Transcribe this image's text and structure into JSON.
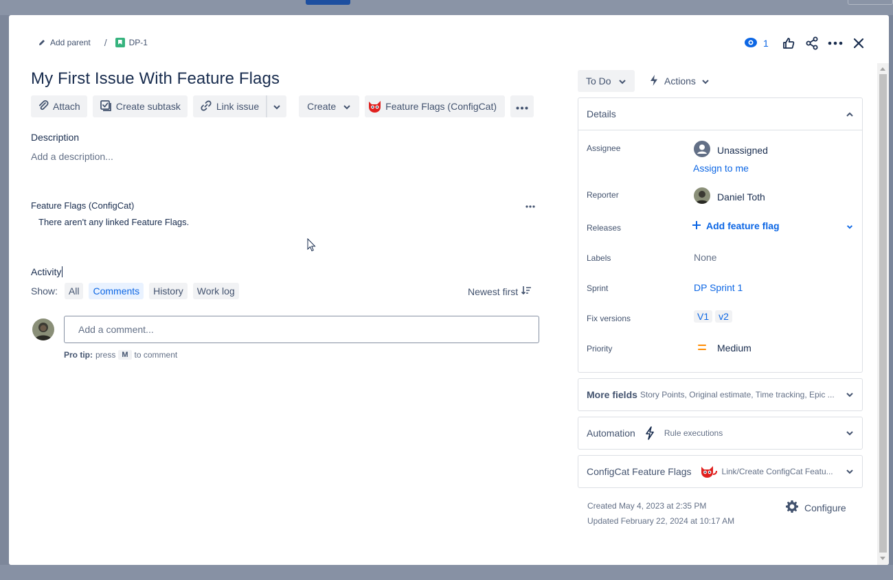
{
  "breadcrumb": {
    "add_parent": "Add parent",
    "separator": "/",
    "issue_key": "DP-1"
  },
  "top_actions": {
    "watch_count": "1"
  },
  "issue": {
    "title": "My First Issue With Feature Flags"
  },
  "toolbar": {
    "attach": "Attach",
    "create_subtask": "Create subtask",
    "link_issue": "Link issue",
    "create": "Create",
    "feature_flags": "Feature Flags (ConfigCat)"
  },
  "description": {
    "label": "Description",
    "placeholder": "Add a description..."
  },
  "feature_flags_section": {
    "label": "Feature Flags (ConfigCat)",
    "empty": "There aren't any linked Feature Flags."
  },
  "activity": {
    "label": "Activity",
    "show_label": "Show:",
    "filters": [
      "All",
      "Comments",
      "History",
      "Work log"
    ],
    "active_filter": "Comments",
    "sort": "Newest first",
    "comment_placeholder": "Add a comment...",
    "protip_bold": "Pro tip:",
    "protip_press": "press",
    "protip_key": "M",
    "protip_rest": "to comment"
  },
  "status": {
    "label": "To Do",
    "actions_label": "Actions"
  },
  "details": {
    "header": "Details",
    "assignee_label": "Assignee",
    "assignee_value": "Unassigned",
    "assign_to_me": "Assign to me",
    "reporter_label": "Reporter",
    "reporter_value": "Daniel Toth",
    "releases_label": "Releases",
    "releases_value": "Add feature flag",
    "labels_label": "Labels",
    "labels_value": "None",
    "sprint_label": "Sprint",
    "sprint_value": "DP Sprint 1",
    "fix_versions_label": "Fix versions",
    "fix_versions": [
      "V1",
      "v2"
    ],
    "priority_label": "Priority",
    "priority_value": "Medium"
  },
  "more_fields": {
    "label": "More fields",
    "sub": "Story Points, Original estimate, Time tracking, Epic ..."
  },
  "automation": {
    "label": "Automation",
    "sub": "Rule executions"
  },
  "configcat": {
    "label": "ConfigCat Feature Flags",
    "sub": "Link/Create ConfigCat Featu..."
  },
  "meta": {
    "created": "Created May 4, 2023 at 2:35 PM",
    "updated": "Updated February 22, 2024 at 10:17 AM",
    "configure": "Configure"
  },
  "colors": {
    "accent": "#0c66e4",
    "story": "#36b37e",
    "priority_medium": "#ff8b00",
    "configcat_red": "#e0201e"
  }
}
